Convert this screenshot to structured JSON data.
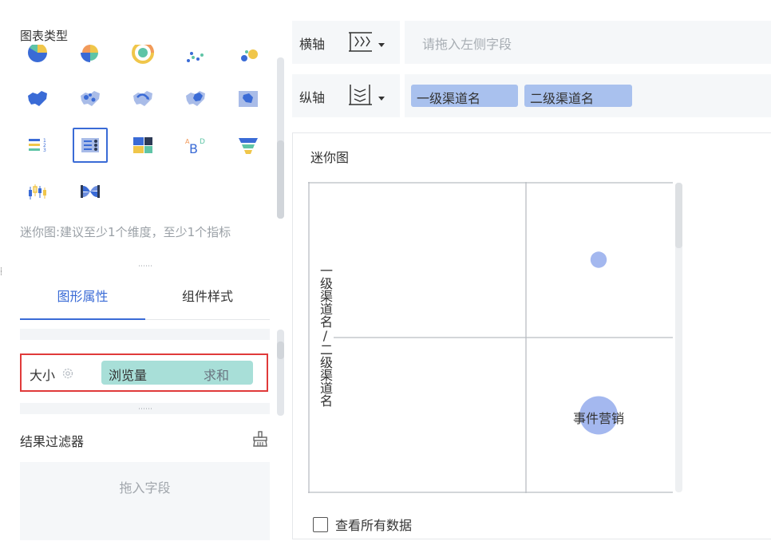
{
  "left_panel": {
    "chart_types_title": "图表类型",
    "chart_types": [
      {
        "name": "pie-chart"
      },
      {
        "name": "rose-chart"
      },
      {
        "name": "sunburst-chart"
      },
      {
        "name": "scatter-chart"
      },
      {
        "name": "bubble-chart"
      },
      {
        "name": "region-map"
      },
      {
        "name": "point-map"
      },
      {
        "name": "flow-map"
      },
      {
        "name": "heat-map"
      },
      {
        "name": "custom-map"
      },
      {
        "name": "ranking-list"
      },
      {
        "name": "mini-chart",
        "selected": true
      },
      {
        "name": "rectangle-tree"
      },
      {
        "name": "word-cloud"
      },
      {
        "name": "funnel-chart"
      },
      {
        "name": "candlestick-chart"
      },
      {
        "name": "sankey-chart"
      }
    ],
    "word_cloud_text": "ABD",
    "hint": "迷你图:建议至少1个维度，至少1个指标",
    "tabs": [
      {
        "label": "图形属性",
        "active": true
      },
      {
        "label": "组件样式",
        "active": false
      }
    ],
    "size_row": {
      "label": "大小",
      "field": "浏览量",
      "aggregation": "求和"
    },
    "filter": {
      "title": "结果过滤器",
      "drop_placeholder": "拖入字段"
    }
  },
  "axes": {
    "x": {
      "label": "横轴",
      "placeholder": "请拖入左侧字段"
    },
    "y": {
      "label": "纵轴",
      "fields": [
        "一级渠道名",
        "二级渠道名"
      ]
    }
  },
  "chart_panel": {
    "title": "迷你图",
    "view_all_label": "查看所有数据",
    "view_all_checked": false
  },
  "chart_data": {
    "type": "scatter",
    "title": "迷你图",
    "ylabel": "一级渠道名/二级渠道名",
    "y_categories": [
      "",
      "事件营销"
    ],
    "points": [
      {
        "category_index": 0,
        "size_value": 1
      },
      {
        "category_index": 1,
        "size_value": 5.5
      }
    ],
    "bubble_color": "#a4b8ef"
  },
  "colors": {
    "accent": "#3a6bd6",
    "highlight_border": "#e03a3a",
    "size_pill": "#a8dfd8",
    "axis_pill": "#a9c1ee"
  }
}
